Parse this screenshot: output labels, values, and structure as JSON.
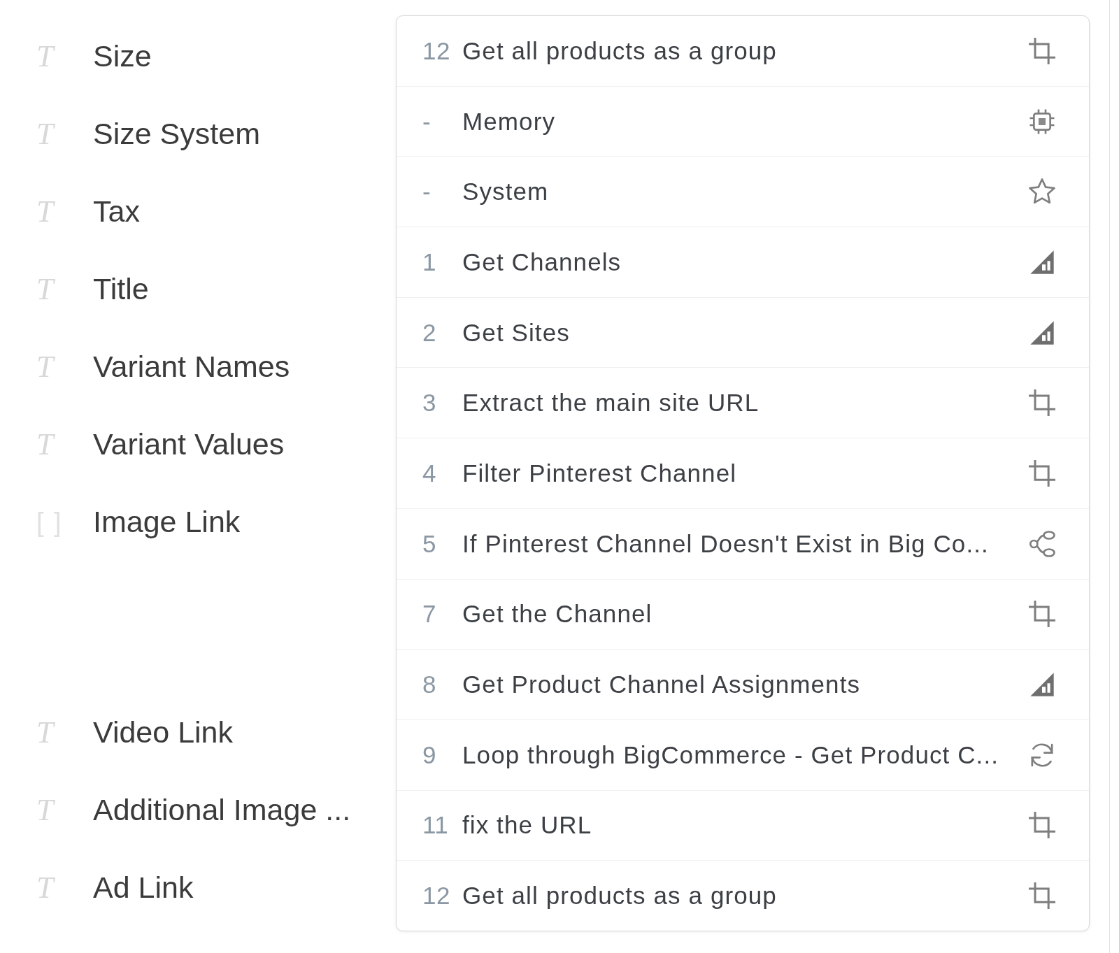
{
  "fields": [
    {
      "icon": "T",
      "label": "Size",
      "kind": "text"
    },
    {
      "icon": "T",
      "label": "Size System",
      "kind": "text"
    },
    {
      "icon": "T",
      "label": "Tax",
      "kind": "text"
    },
    {
      "icon": "T",
      "label": "Title",
      "kind": "text"
    },
    {
      "icon": "T",
      "label": "Variant Names",
      "kind": "text"
    },
    {
      "icon": "T",
      "label": "Variant Values",
      "kind": "text"
    },
    {
      "icon": "[ ]",
      "label": "Image Link",
      "kind": "array"
    },
    {
      "icon": "T",
      "label": "Video Link",
      "kind": "text"
    },
    {
      "icon": "T",
      "label": "Additional Image ...",
      "kind": "text"
    },
    {
      "icon": "T",
      "label": "Ad Link",
      "kind": "text"
    }
  ],
  "step_menu": {
    "items": [
      {
        "number": "12",
        "label": "Get all products as a group",
        "kind": "crop"
      },
      {
        "number": "-",
        "label": "Memory",
        "kind": "chip"
      },
      {
        "number": "-",
        "label": "System",
        "kind": "star"
      },
      {
        "number": "1",
        "label": "Get Channels",
        "kind": "api"
      },
      {
        "number": "2",
        "label": "Get Sites",
        "kind": "api"
      },
      {
        "number": "3",
        "label": "Extract the main site URL",
        "kind": "crop"
      },
      {
        "number": "4",
        "label": "Filter Pinterest Channel",
        "kind": "crop"
      },
      {
        "number": "5",
        "label": "If Pinterest Channel Doesn't Exist in Big Co...",
        "kind": "branch"
      },
      {
        "number": "7",
        "label": "Get the Channel",
        "kind": "crop"
      },
      {
        "number": "8",
        "label": "Get Product Channel Assignments",
        "kind": "api"
      },
      {
        "number": "9",
        "label": "Loop through BigCommerce - Get Product C...",
        "kind": "loop"
      },
      {
        "number": "11",
        "label": "fix the URL",
        "kind": "crop"
      },
      {
        "number": "12",
        "label": "Get all products as a group",
        "kind": "crop"
      }
    ]
  }
}
